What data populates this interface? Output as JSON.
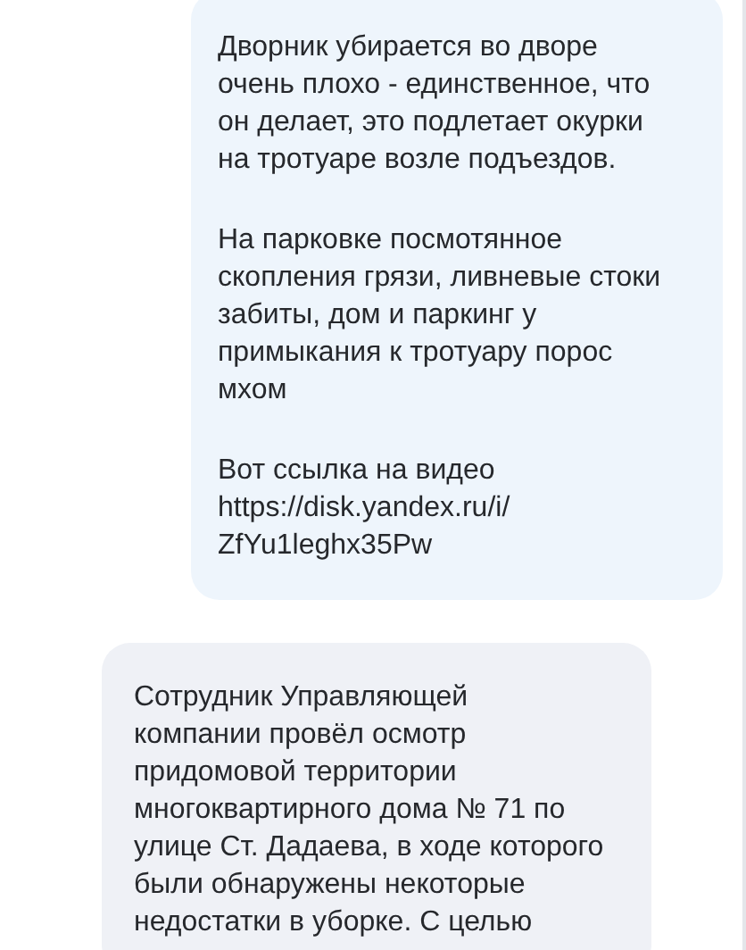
{
  "messages": [
    {
      "kind": "outgoing",
      "paragraphs": [
        [
          "Дворник убирается во дворе",
          "очень плохо - единственное, что",
          "он делает, это подлетает окурки",
          "на тротуаре возле подъездов."
        ],
        [
          "На парковке посмотянное",
          "скопления грязи, ливневые стоки",
          "забиты, дом и паркинг у",
          "примыкания к тротуару порос",
          "мхом"
        ],
        [
          "Вот ссылка на видео",
          "https://disk.yandex.ru/i/",
          "ZfYu1leghx35Pw"
        ]
      ]
    },
    {
      "kind": "incoming",
      "paragraphs": [
        [
          "Сотрудник Управляющей",
          "компании провёл осмотр",
          "придомовой территории",
          "многоквартирного дома № 71 по",
          "улице Ст. Дадаева, в ходе которого",
          "были обнаружены некоторые",
          "недостатки в уборке. С целью"
        ]
      ]
    }
  ]
}
